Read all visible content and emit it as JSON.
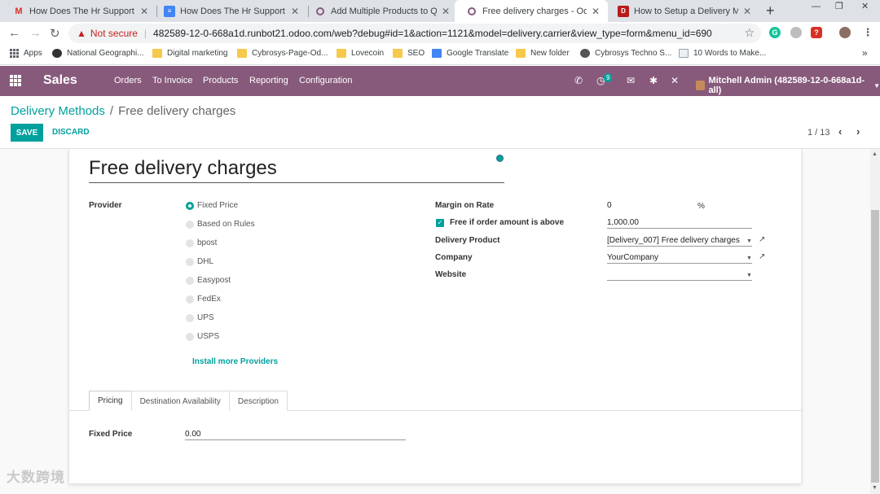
{
  "browser": {
    "tabs": [
      {
        "title": "How Does The Hr Support Busin",
        "icon": "gmail-icon",
        "icon_color": "#d93025",
        "active": false
      },
      {
        "title": "How Does The Hr Support Busin",
        "icon": "doc-icon",
        "icon_color": "#4285f4",
        "active": false
      },
      {
        "title": "Add Multiple Products to Quota",
        "icon": "odoo-icon",
        "icon_color": "#875a7b",
        "active": false
      },
      {
        "title": "Free delivery charges - Odoo",
        "icon": "odoo-icon",
        "icon_color": "#875a7b",
        "active": true
      },
      {
        "title": "How to Setup a Delivery Metho",
        "icon": "site-icon",
        "icon_color": "#b71c1c",
        "active": false
      }
    ],
    "new_tab": "+",
    "security": "Not secure",
    "url": "482589-12-0-668a1d.runbot21.odoo.com/web?debug#id=1&action=1121&model=delivery.carrier&view_type=form&menu_id=690",
    "bookmarks": [
      {
        "label": "Apps",
        "icon": "apps-icon"
      },
      {
        "label": "National Geographi...",
        "icon": "natgeo-icon"
      },
      {
        "label": "Digital marketing",
        "icon": "folder-icon"
      },
      {
        "label": "Cybrosys-Page-Od...",
        "icon": "folder-icon"
      },
      {
        "label": "Lovecoin",
        "icon": "folder-icon"
      },
      {
        "label": "SEO",
        "icon": "folder-icon"
      },
      {
        "label": "Google Translate",
        "icon": "translate-icon"
      },
      {
        "label": "New folder",
        "icon": "folder-icon"
      },
      {
        "label": "Cybrosys Techno S...",
        "icon": "globe-icon"
      },
      {
        "label": "10 Words to Make...",
        "icon": "page-icon"
      }
    ],
    "more_bookmarks": "»"
  },
  "odoo": {
    "brand": "Sales",
    "menu": [
      "Orders",
      "To Invoice",
      "Products",
      "Reporting",
      "Configuration"
    ],
    "activity_count": "9",
    "user": "Mitchell Admin (482589-12-0-668a1d-all)"
  },
  "control": {
    "breadcrumb_parent": "Delivery Methods",
    "breadcrumb_sep": "/",
    "breadcrumb_current": "Free delivery charges",
    "save_label": "SAVE",
    "discard_label": "DISCARD",
    "pager": "1 / 13"
  },
  "form": {
    "name": "Free delivery charges",
    "provider_label": "Provider",
    "providers": [
      {
        "label": "Fixed Price",
        "selected": true
      },
      {
        "label": "Based on Rules",
        "selected": false
      },
      {
        "label": "bpost",
        "selected": false
      },
      {
        "label": "DHL",
        "selected": false
      },
      {
        "label": "Easypost",
        "selected": false
      },
      {
        "label": "FedEx",
        "selected": false
      },
      {
        "label": "UPS",
        "selected": false
      },
      {
        "label": "USPS",
        "selected": false
      }
    ],
    "install_more": "Install more Providers",
    "margin_label": "Margin on Rate",
    "margin_value": "0",
    "margin_unit": "%",
    "free_label": "Free if order amount is above",
    "free_checked": true,
    "free_value": "1,000.00",
    "delivery_product_label": "Delivery Product",
    "delivery_product_value": "[Delivery_007] Free delivery charges",
    "company_label": "Company",
    "company_value": "YourCompany",
    "website_label": "Website",
    "website_value": "",
    "tabs": [
      "Pricing",
      "Destination Availability",
      "Description"
    ],
    "fixed_price_label": "Fixed Price",
    "fixed_price_value": "0.00"
  },
  "watermark": "大数跨境",
  "colors": {
    "primary": "#875a7b",
    "accent": "#00a09d"
  }
}
